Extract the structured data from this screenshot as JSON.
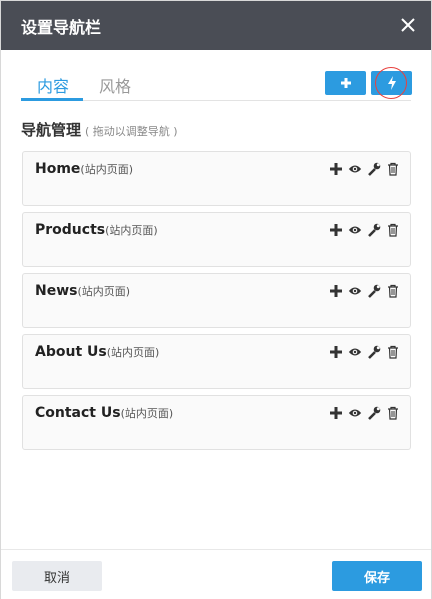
{
  "dialog": {
    "title": "设置导航栏",
    "close_icon": "close-icon"
  },
  "tabs": [
    {
      "label": "内容",
      "active": true
    },
    {
      "label": "风格",
      "active": false
    }
  ],
  "toolbar": {
    "add_icon": "plus-icon",
    "quick_icon": "lightning-icon"
  },
  "section": {
    "title": "导航管理",
    "hint": "( 拖动以调整导航 )"
  },
  "nav_items": [
    {
      "label": "Home",
      "type": "(站内页面)"
    },
    {
      "label": "Products",
      "type": "(站内页面)"
    },
    {
      "label": "News",
      "type": "(站内页面)"
    },
    {
      "label": "About Us",
      "type": "(站内页面)"
    },
    {
      "label": "Contact Us",
      "type": "(站内页面)"
    }
  ],
  "item_actions": [
    "plus-icon",
    "eye-icon",
    "wrench-icon",
    "trash-icon"
  ],
  "footer": {
    "cancel_label": "取消",
    "save_label": "保存"
  },
  "colors": {
    "header_bg": "#4a4d55",
    "accent": "#2c9be0",
    "highlight_ring": "#e8413e"
  }
}
